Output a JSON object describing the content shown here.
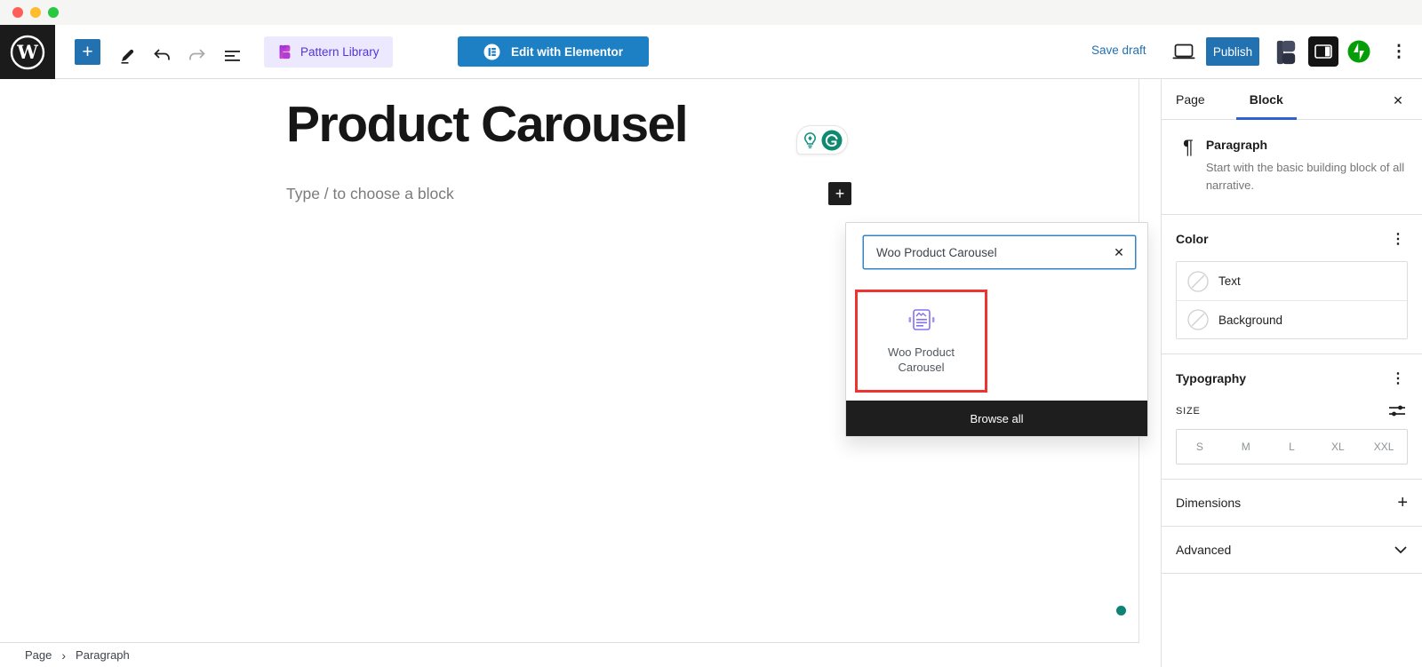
{
  "toolbar": {
    "pattern_library_label": "Pattern Library",
    "elementor_button_label": "Edit with Elementor",
    "save_draft_label": "Save draft",
    "publish_label": "Publish"
  },
  "canvas": {
    "post_title": "Product Carousel",
    "block_placeholder": "Type / to choose a block"
  },
  "inserter": {
    "search_value": "Woo Product Carousel",
    "result_title": "Woo Product Carousel",
    "browse_all_label": "Browse all"
  },
  "sidebar": {
    "tab_page": "Page",
    "tab_block": "Block",
    "block_card": {
      "title": "Paragraph",
      "description": "Start with the basic building block of all narrative."
    },
    "color": {
      "title": "Color",
      "items": [
        "Text",
        "Background"
      ]
    },
    "typography": {
      "title": "Typography",
      "size_label": "SIZE",
      "sizes": [
        "S",
        "M",
        "L",
        "XL",
        "XXL"
      ]
    },
    "dimensions": {
      "title": "Dimensions"
    },
    "advanced": {
      "title": "Advanced"
    }
  },
  "footer": {
    "breadcrumb": [
      "Page",
      "Paragraph"
    ]
  },
  "icons": {
    "plus": "+",
    "close": "✕",
    "kebab": "⋮",
    "pilcrow": "¶",
    "breadcrumb_chevron": "›",
    "chevron_down": "⌄"
  },
  "colors": {
    "admin_blue": "#2271b1",
    "elementor_blue": "#1d80c4",
    "focus_border_blue": "#3582c4",
    "active_tab_blue": "#2f62d0",
    "annotation_red": "#ee3333",
    "jetpack_green": "#069e08",
    "grammarly_green": "#0e8a70",
    "pattern_library_purple": "#5335d8",
    "block_icon_purple": "#8670f2",
    "status_dot_teal": "#0d8276"
  }
}
